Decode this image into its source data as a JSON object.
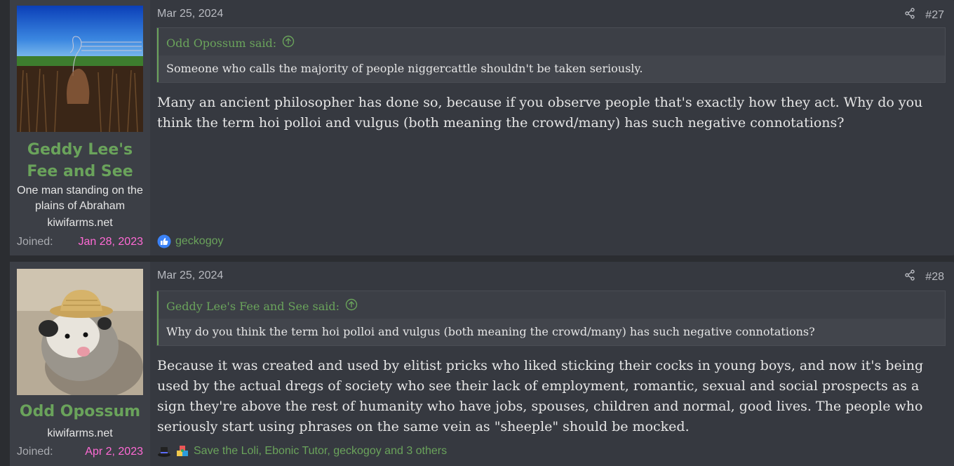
{
  "posts": [
    {
      "user": {
        "name": "Geddy Lee's Fee and See",
        "title": "One man standing on the plains of Abraham",
        "site": "kiwifarms.net",
        "joined_label": "Joined:",
        "joined_date": "Jan 28, 2023",
        "avatar_icon": "avatar-geddy-image"
      },
      "date": "Mar 25, 2024",
      "number": "#27",
      "quote": {
        "author": "Odd Opossum said:",
        "text": "Someone who calls the majority of people niggercattle shouldn't be taken seriously."
      },
      "body": "Many an ancient philosopher has done so, because if you observe people that's exactly how they act. Why do you think the term hoi polloi and vulgus (both meaning the crowd/many) has such negative connotations?",
      "reactions": "geckogoy"
    },
    {
      "user": {
        "name": "Odd Opossum",
        "site": "kiwifarms.net",
        "joined_label": "Joined:",
        "joined_date": "Apr 2, 2023",
        "avatar_icon": "avatar-opossum-image"
      },
      "date": "Mar 25, 2024",
      "number": "#28",
      "quote": {
        "author": "Geddy Lee's Fee and See said:",
        "text": "Why do you think the term hoi polloi and vulgus (both meaning the crowd/many) has such negative connotations?"
      },
      "body": "Because it was created and used by elitist pricks who liked sticking their cocks in young boys, and now it's being used by the actual dregs of society who see their lack of employment, romantic, sexual and social prospects as a sign they're above the rest of humanity who have jobs, spouses, children and normal, good lives. The people who seriously start using phrases on the same vein as \"sheeple\" should be mocked.",
      "reactions": "Save the Loli, Ebonic Tutor, geckogoy and 3 others"
    }
  ],
  "colors": {
    "accent_green": "#6aa35b",
    "joined_pink": "#ff6ad5",
    "background": "#2b2d31"
  }
}
